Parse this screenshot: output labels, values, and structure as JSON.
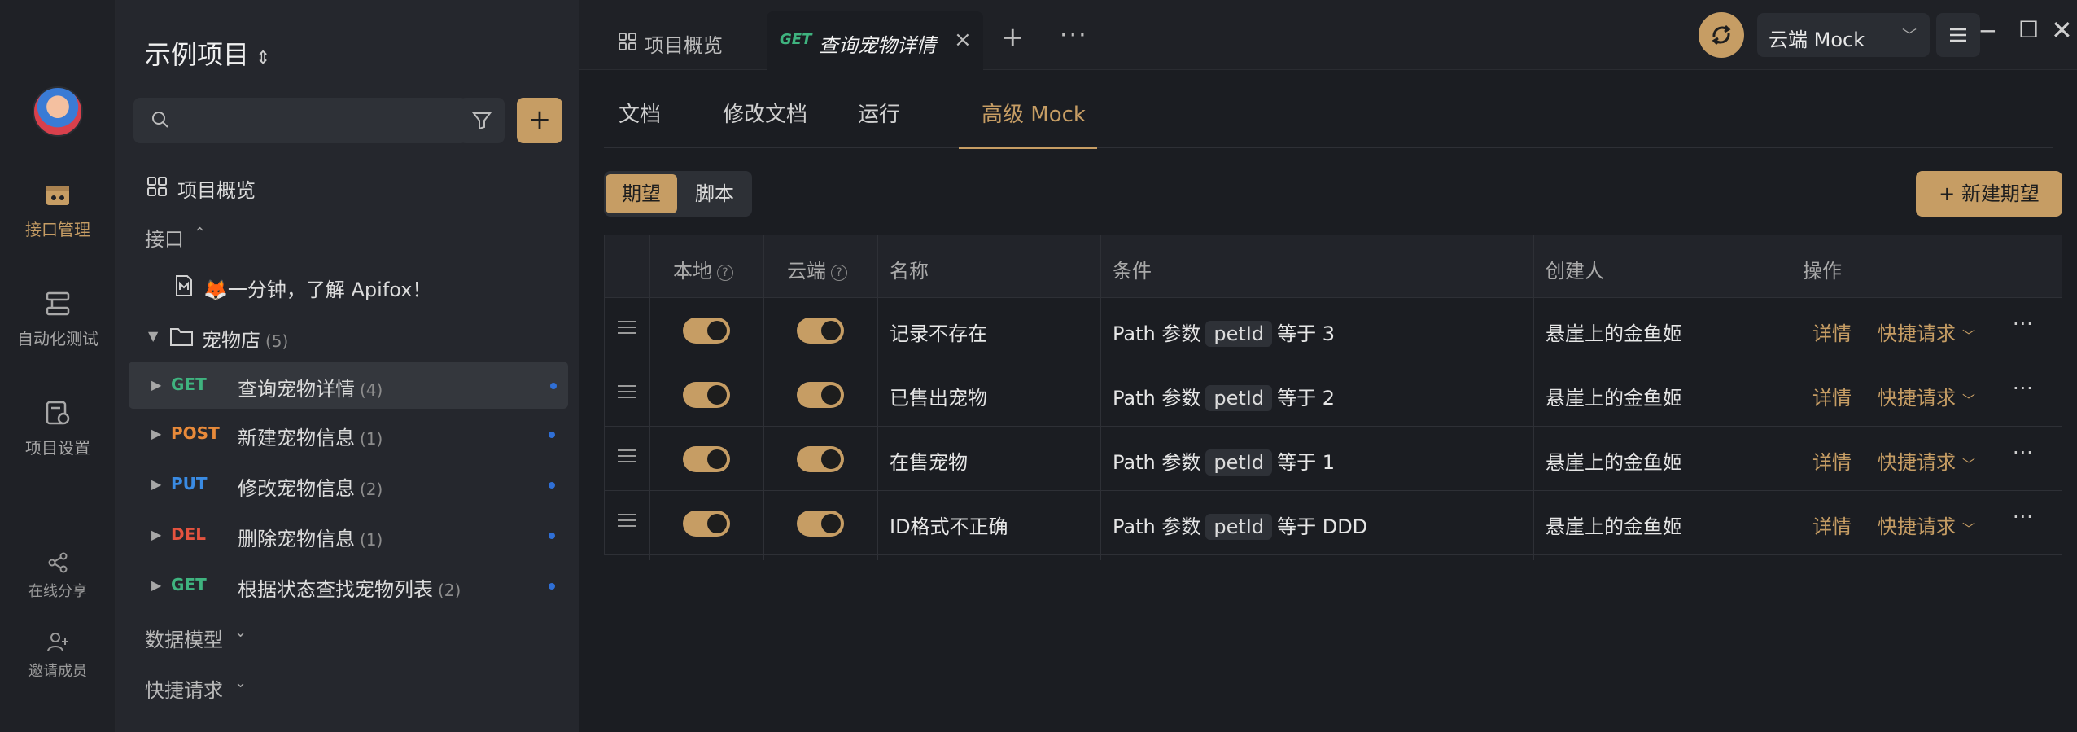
{
  "rail": {
    "items": [
      {
        "label": "接口管理",
        "icon": "api-management-icon"
      },
      {
        "label": "自动化测试",
        "icon": "automation-test-icon"
      },
      {
        "label": "项目设置",
        "icon": "project-settings-icon"
      },
      {
        "label": "在线分享",
        "icon": "share-icon"
      },
      {
        "label": "邀请成员",
        "icon": "invite-member-icon"
      }
    ]
  },
  "sidebar": {
    "project_title": "示例项目",
    "search": {
      "placeholder": ""
    },
    "overview": "项目概览",
    "api_section": "接口",
    "intro_doc": "🦊一分钟，了解 Apifox！",
    "folder": {
      "label": "宠物店",
      "count": "(5)"
    },
    "endpoints": [
      {
        "method": "GET",
        "label": "查询宠物详情",
        "count": "(4)"
      },
      {
        "method": "POST",
        "label": "新建宠物信息",
        "count": "(1)"
      },
      {
        "method": "PUT",
        "label": "修改宠物信息",
        "count": "(2)"
      },
      {
        "method": "DEL",
        "label": "删除宠物信息",
        "count": "(1)"
      },
      {
        "method": "GET",
        "label": "根据状态查找宠物列表",
        "count": "(2)"
      }
    ],
    "data_models": "数据模型",
    "quick_requests": "快捷请求"
  },
  "topbar": {
    "tabs": [
      {
        "label": "项目概览"
      },
      {
        "method": "GET",
        "label": "查询宠物详情"
      }
    ],
    "env": "云端 Mock"
  },
  "main": {
    "subtabs": [
      "文档",
      "修改文档",
      "运行",
      "高级 Mock"
    ],
    "segments": [
      "期望",
      "脚本"
    ],
    "new_button": "+ 新建期望",
    "columns": [
      "本地",
      "云端",
      "名称",
      "条件",
      "创建人",
      "操作"
    ],
    "rows": [
      {
        "name": "记录不存在",
        "cond_prefix": "Path 参数",
        "param": "petId",
        "cond_suffix": "等于 3",
        "creator": "悬崖上的金鱼姬",
        "detail": "详情",
        "quick": "快捷请求"
      },
      {
        "name": "已售出宠物",
        "cond_prefix": "Path 参数",
        "param": "petId",
        "cond_suffix": "等于 2",
        "creator": "悬崖上的金鱼姬",
        "detail": "详情",
        "quick": "快捷请求"
      },
      {
        "name": "在售宠物",
        "cond_prefix": "Path 参数",
        "param": "petId",
        "cond_suffix": "等于 1",
        "creator": "悬崖上的金鱼姬",
        "detail": "详情",
        "quick": "快捷请求"
      },
      {
        "name": "ID格式不正确",
        "cond_prefix": "Path 参数",
        "param": "petId",
        "cond_suffix": "等于 DDD",
        "creator": "悬崖上的金鱼姬",
        "detail": "详情",
        "quick": "快捷请求"
      }
    ]
  },
  "colors": {
    "accent": "#c69d64",
    "get": "#3fb37f",
    "post": "#e88a3a",
    "put": "#3a8be3",
    "del": "#e5533f"
  }
}
